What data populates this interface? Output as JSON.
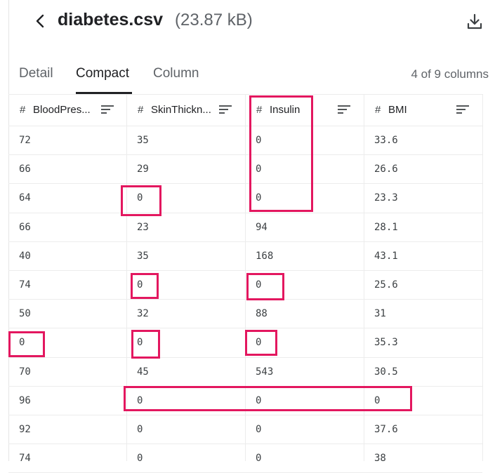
{
  "header": {
    "title": "diabetes.csv",
    "size": "(23.87 kB)",
    "download_icon": "download-icon",
    "back_icon": "chevron-left-icon"
  },
  "tabs": [
    {
      "label": "Detail",
      "active": false
    },
    {
      "label": "Compact",
      "active": true
    },
    {
      "label": "Column",
      "active": false
    }
  ],
  "column_count": "4 of 9 columns",
  "columns": [
    {
      "type_icon": "#",
      "name": "BloodPres..."
    },
    {
      "type_icon": "#",
      "name": "SkinThickn..."
    },
    {
      "type_icon": "#",
      "name": "Insulin"
    },
    {
      "type_icon": "#",
      "name": "BMI"
    }
  ],
  "rows": [
    [
      "72",
      "35",
      "0",
      "33.6"
    ],
    [
      "66",
      "29",
      "0",
      "26.6"
    ],
    [
      "64",
      "0",
      "0",
      "23.3"
    ],
    [
      "66",
      "23",
      "94",
      "28.1"
    ],
    [
      "40",
      "35",
      "168",
      "43.1"
    ],
    [
      "74",
      "0",
      "0",
      "25.6"
    ],
    [
      "50",
      "32",
      "88",
      "31"
    ],
    [
      "0",
      "0",
      "0",
      "35.3"
    ],
    [
      "70",
      "45",
      "543",
      "30.5"
    ],
    [
      "96",
      "0",
      "0",
      "0"
    ],
    [
      "92",
      "0",
      "0",
      "37.6"
    ],
    [
      "74",
      "0",
      "0",
      "38"
    ]
  ],
  "highlight_color": "#e3175f",
  "text_color": "#202124",
  "muted_color": "#5f6368"
}
